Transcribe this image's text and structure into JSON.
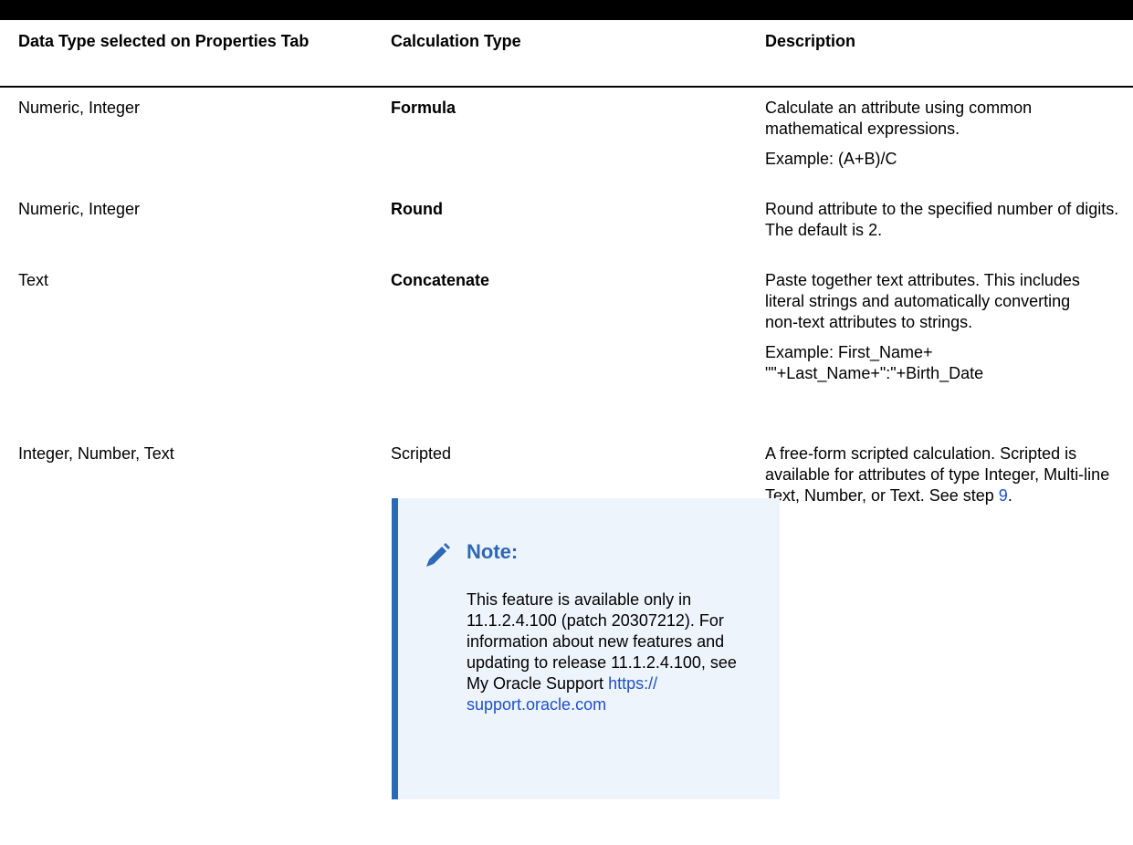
{
  "headers": {
    "col1": "Data Type selected on Properties Tab",
    "col2": "Calculation Type",
    "col3": "Description"
  },
  "rows": [
    {
      "data_type": "Numeric, Integer",
      "calc_type": "Formula",
      "desc": "Calculate an attribute using common mathematical expressions.",
      "example": "Example: (A+B)/C"
    },
    {
      "data_type": "Numeric, Integer",
      "calc_type": "Round",
      "desc": "Round attribute to the specified number of digits. The default is 2."
    },
    {
      "data_type": "Text",
      "calc_type": "Concatenate",
      "desc": "Paste together text attributes. This includes literal strings and automatically converting non-text attributes to strings.",
      "example": "Example: First_Name+ \"\"+Last_Name+\":\"+Birth_Date"
    },
    {
      "data_type": "Integer, Number, Text",
      "calc_type": "Scripted",
      "desc_prefix": "A free-form scripted calculation. Scripted is available for attributes of type Integer, Multi-line Text, Number, or Text. See step ",
      "desc_link": "9",
      "desc_suffix": "."
    }
  ],
  "note": {
    "title": "Note:",
    "body_text": "This feature is available only in 11.1.2.4.100 (patch 20307212). For information about new features and updating to release 11.1.2.4.100, see My Oracle Support ",
    "link_text": "https:// support.oracle.com",
    "icon": "pencil-icon"
  },
  "colors": {
    "link": "#1e50c8",
    "note_accent": "#2e68b4",
    "note_background": "#eef4fc"
  }
}
